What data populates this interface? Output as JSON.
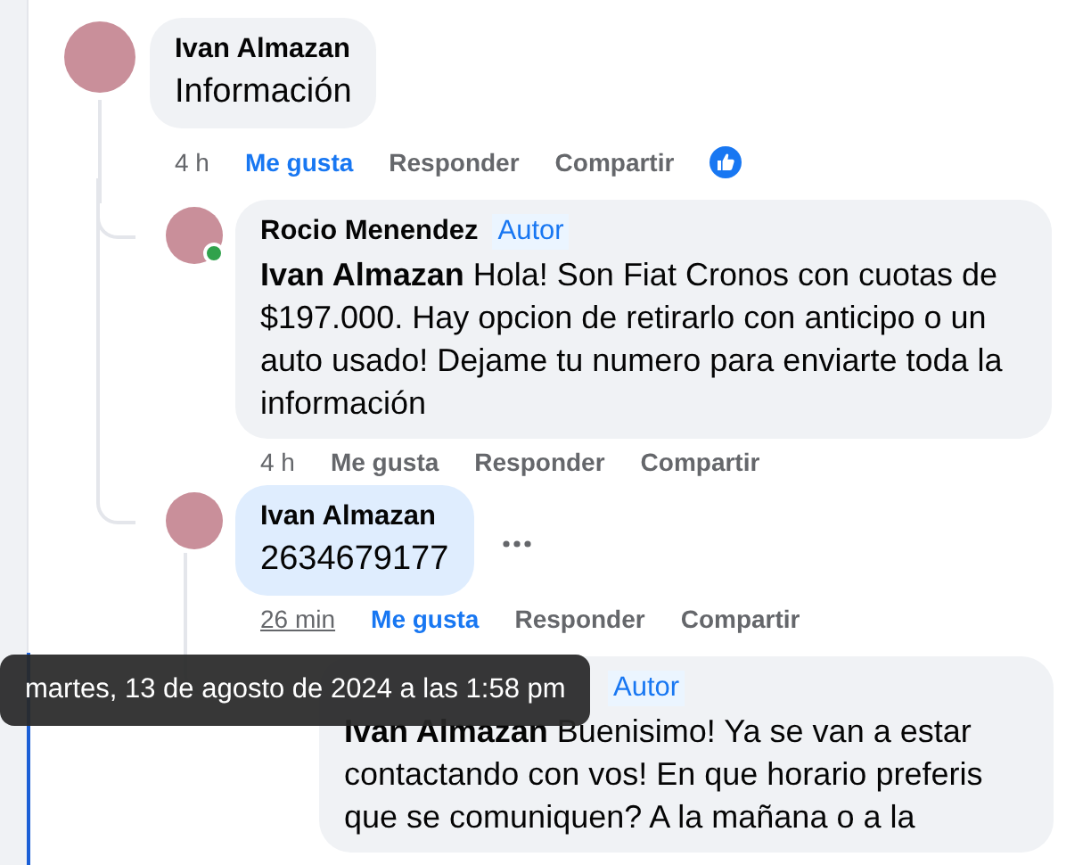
{
  "comments": [
    {
      "author": "Ivan Almazan",
      "text": "Información",
      "highlighted": false,
      "time": "4 h",
      "time_underlined": false,
      "liked": true,
      "reactions": true,
      "actions": [
        "Me gusta",
        "Responder",
        "Compartir"
      ],
      "children": [
        {
          "author": "Rocio Menendez",
          "badge": "Autor",
          "mention": "Ivan Almazan",
          "text": "Hola! Son Fiat Cronos con cuotas de $197.000. Hay opcion de retirarlo con anticipo o un auto usado! Dejame tu numero para enviarte toda la información",
          "highlighted": false,
          "online": true,
          "time": "4 h",
          "time_underlined": false,
          "liked": false,
          "actions": [
            "Me gusta",
            "Responder",
            "Compartir"
          ]
        },
        {
          "author": "Ivan Almazan",
          "text": "2634679177",
          "highlighted": true,
          "time": "26 min",
          "time_underlined": true,
          "liked": true,
          "more_button": true,
          "actions": [
            "Me gusta",
            "Responder",
            "Compartir"
          ],
          "children": [
            {
              "badge": "Autor",
              "mention": "Ivan Almazan",
              "text": "Buenisimo! Ya se van a estar contactando con vos! En que horario preferis que se comuniquen? A la mañana o a la",
              "highlighted": false
            }
          ]
        }
      ]
    }
  ],
  "tooltip": {
    "text": "martes, 13 de agosto de 2024 a las 1:58 pm"
  }
}
